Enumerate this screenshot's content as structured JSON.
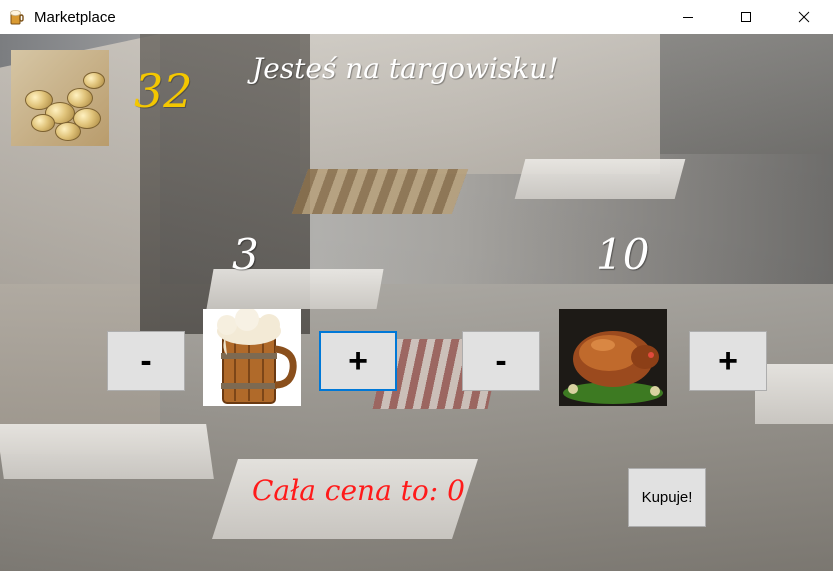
{
  "window": {
    "title": "Marketplace",
    "icon": "beer-mug-icon",
    "controls": [
      "minimize-icon",
      "maximize-icon",
      "close-icon"
    ]
  },
  "header": {
    "coins": "32",
    "coins_image": "gold-coins-image",
    "message": "Jesteś na targowisku!"
  },
  "products": [
    {
      "name_icon": "beer-mug-image",
      "quantity": "3",
      "minus_label": "-",
      "plus_label": "+"
    },
    {
      "name_icon": "roast-pig-image",
      "quantity": "10",
      "minus_label": "-",
      "plus_label": "+"
    }
  ],
  "summary": {
    "total_text": "Cała cena to: 0",
    "buy_label": "Kupuje!"
  },
  "colors": {
    "coins": "#f4c700",
    "headline": "#ffffff",
    "total": "#ff1a1a",
    "button_bg": "#e1e1e1",
    "focus": "#0078d7"
  }
}
